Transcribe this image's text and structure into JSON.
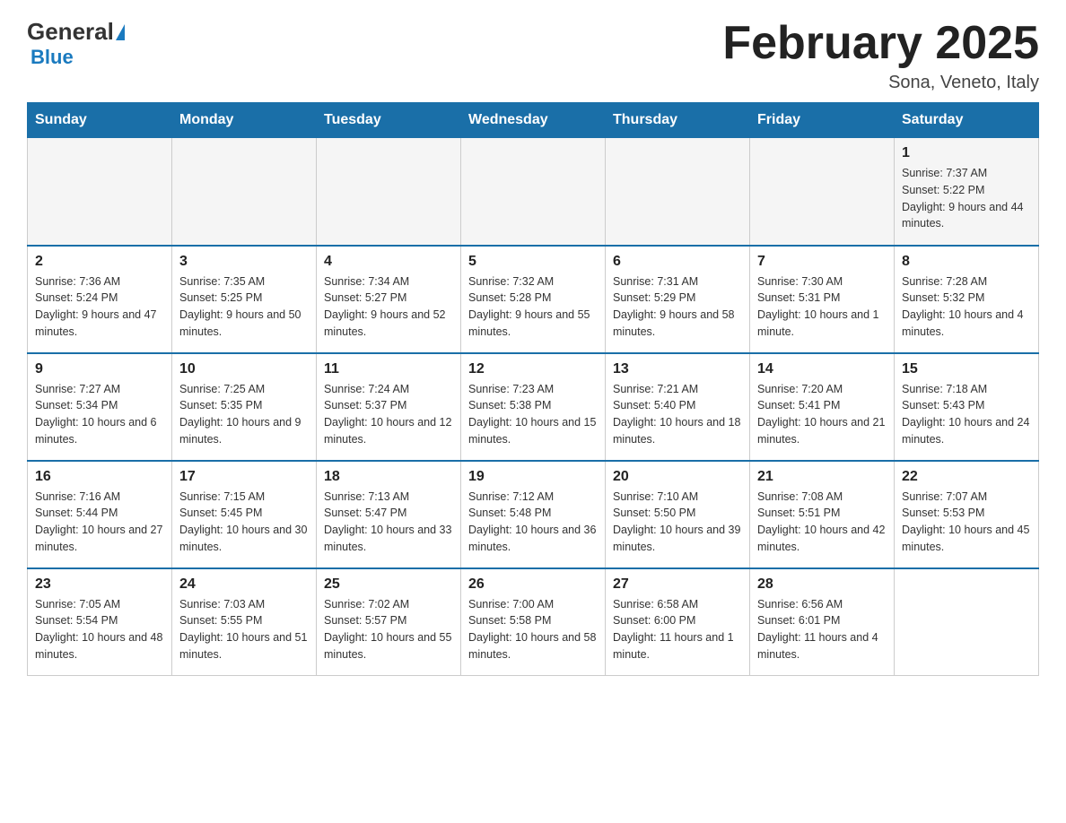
{
  "header": {
    "logo": {
      "general": "General",
      "blue": "Blue",
      "triangle": "▲"
    },
    "title": "February 2025",
    "location": "Sona, Veneto, Italy"
  },
  "days_of_week": [
    "Sunday",
    "Monday",
    "Tuesday",
    "Wednesday",
    "Thursday",
    "Friday",
    "Saturday"
  ],
  "weeks": [
    [
      {
        "day": "",
        "info": ""
      },
      {
        "day": "",
        "info": ""
      },
      {
        "day": "",
        "info": ""
      },
      {
        "day": "",
        "info": ""
      },
      {
        "day": "",
        "info": ""
      },
      {
        "day": "",
        "info": ""
      },
      {
        "day": "1",
        "info": "Sunrise: 7:37 AM\nSunset: 5:22 PM\nDaylight: 9 hours and 44 minutes."
      }
    ],
    [
      {
        "day": "2",
        "info": "Sunrise: 7:36 AM\nSunset: 5:24 PM\nDaylight: 9 hours and 47 minutes."
      },
      {
        "day": "3",
        "info": "Sunrise: 7:35 AM\nSunset: 5:25 PM\nDaylight: 9 hours and 50 minutes."
      },
      {
        "day": "4",
        "info": "Sunrise: 7:34 AM\nSunset: 5:27 PM\nDaylight: 9 hours and 52 minutes."
      },
      {
        "day": "5",
        "info": "Sunrise: 7:32 AM\nSunset: 5:28 PM\nDaylight: 9 hours and 55 minutes."
      },
      {
        "day": "6",
        "info": "Sunrise: 7:31 AM\nSunset: 5:29 PM\nDaylight: 9 hours and 58 minutes."
      },
      {
        "day": "7",
        "info": "Sunrise: 7:30 AM\nSunset: 5:31 PM\nDaylight: 10 hours and 1 minute."
      },
      {
        "day": "8",
        "info": "Sunrise: 7:28 AM\nSunset: 5:32 PM\nDaylight: 10 hours and 4 minutes."
      }
    ],
    [
      {
        "day": "9",
        "info": "Sunrise: 7:27 AM\nSunset: 5:34 PM\nDaylight: 10 hours and 6 minutes."
      },
      {
        "day": "10",
        "info": "Sunrise: 7:25 AM\nSunset: 5:35 PM\nDaylight: 10 hours and 9 minutes."
      },
      {
        "day": "11",
        "info": "Sunrise: 7:24 AM\nSunset: 5:37 PM\nDaylight: 10 hours and 12 minutes."
      },
      {
        "day": "12",
        "info": "Sunrise: 7:23 AM\nSunset: 5:38 PM\nDaylight: 10 hours and 15 minutes."
      },
      {
        "day": "13",
        "info": "Sunrise: 7:21 AM\nSunset: 5:40 PM\nDaylight: 10 hours and 18 minutes."
      },
      {
        "day": "14",
        "info": "Sunrise: 7:20 AM\nSunset: 5:41 PM\nDaylight: 10 hours and 21 minutes."
      },
      {
        "day": "15",
        "info": "Sunrise: 7:18 AM\nSunset: 5:43 PM\nDaylight: 10 hours and 24 minutes."
      }
    ],
    [
      {
        "day": "16",
        "info": "Sunrise: 7:16 AM\nSunset: 5:44 PM\nDaylight: 10 hours and 27 minutes."
      },
      {
        "day": "17",
        "info": "Sunrise: 7:15 AM\nSunset: 5:45 PM\nDaylight: 10 hours and 30 minutes."
      },
      {
        "day": "18",
        "info": "Sunrise: 7:13 AM\nSunset: 5:47 PM\nDaylight: 10 hours and 33 minutes."
      },
      {
        "day": "19",
        "info": "Sunrise: 7:12 AM\nSunset: 5:48 PM\nDaylight: 10 hours and 36 minutes."
      },
      {
        "day": "20",
        "info": "Sunrise: 7:10 AM\nSunset: 5:50 PM\nDaylight: 10 hours and 39 minutes."
      },
      {
        "day": "21",
        "info": "Sunrise: 7:08 AM\nSunset: 5:51 PM\nDaylight: 10 hours and 42 minutes."
      },
      {
        "day": "22",
        "info": "Sunrise: 7:07 AM\nSunset: 5:53 PM\nDaylight: 10 hours and 45 minutes."
      }
    ],
    [
      {
        "day": "23",
        "info": "Sunrise: 7:05 AM\nSunset: 5:54 PM\nDaylight: 10 hours and 48 minutes."
      },
      {
        "day": "24",
        "info": "Sunrise: 7:03 AM\nSunset: 5:55 PM\nDaylight: 10 hours and 51 minutes."
      },
      {
        "day": "25",
        "info": "Sunrise: 7:02 AM\nSunset: 5:57 PM\nDaylight: 10 hours and 55 minutes."
      },
      {
        "day": "26",
        "info": "Sunrise: 7:00 AM\nSunset: 5:58 PM\nDaylight: 10 hours and 58 minutes."
      },
      {
        "day": "27",
        "info": "Sunrise: 6:58 AM\nSunset: 6:00 PM\nDaylight: 11 hours and 1 minute."
      },
      {
        "day": "28",
        "info": "Sunrise: 6:56 AM\nSunset: 6:01 PM\nDaylight: 11 hours and 4 minutes."
      },
      {
        "day": "",
        "info": ""
      }
    ]
  ]
}
